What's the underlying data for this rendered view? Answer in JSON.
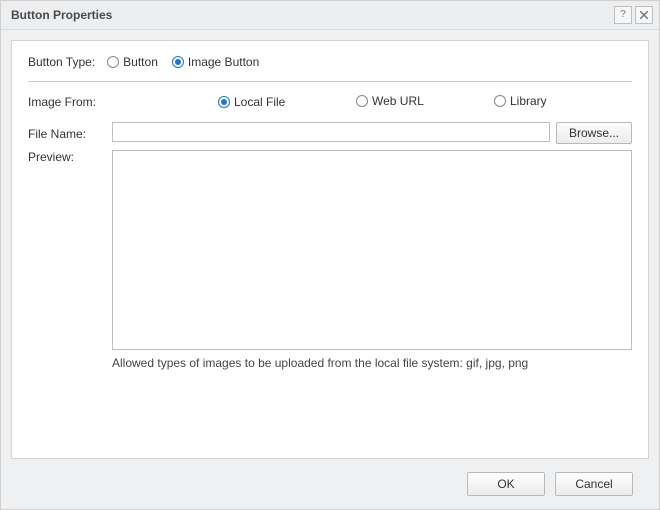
{
  "dialog": {
    "title": "Button Properties"
  },
  "buttonType": {
    "label": "Button Type:",
    "options": {
      "button": "Button",
      "imageButton": "Image Button"
    },
    "selected": "imageButton"
  },
  "imageFrom": {
    "label": "Image From:",
    "options": {
      "localFile": "Local File",
      "webUrl": "Web URL",
      "library": "Library"
    },
    "selected": "localFile"
  },
  "fileName": {
    "label": "File Name:",
    "value": "",
    "browse": "Browse..."
  },
  "preview": {
    "label": "Preview:"
  },
  "hint": "Allowed types of images to be uploaded from the local file system: gif, jpg, png",
  "footer": {
    "ok": "OK",
    "cancel": "Cancel"
  }
}
